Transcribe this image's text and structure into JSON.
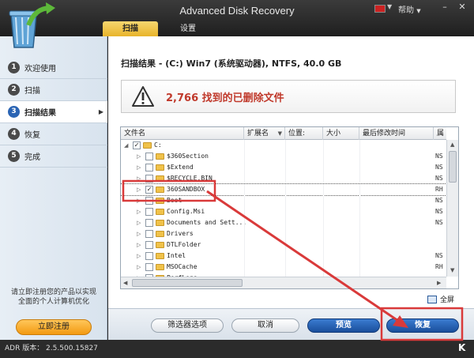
{
  "app": {
    "title": "Advanced Disk Recovery",
    "help_label": "帮助",
    "help_arrow": "▼",
    "minimize": "–",
    "close": "✕"
  },
  "tabs": [
    {
      "label": "扫描",
      "active": true
    },
    {
      "label": "设置",
      "active": false
    }
  ],
  "sidebar": {
    "items": [
      {
        "num": "1",
        "label": "欢迎使用",
        "active": false
      },
      {
        "num": "2",
        "label": "扫描",
        "active": false
      },
      {
        "num": "3",
        "label": "扫描结果",
        "active": true
      },
      {
        "num": "4",
        "label": "恢复",
        "active": false
      },
      {
        "num": "5",
        "label": "完成",
        "active": false
      }
    ],
    "promo_line1": "请立即注册您的产品以实现",
    "promo_line2": "全面的个人计算机优化",
    "register_label": "立即注册"
  },
  "main": {
    "heading": "扫描结果 - (C:) Win7 (系统驱动器), NTFS, 40.0 GB",
    "found_text": "2,766 找到的已删除文件",
    "columns": [
      "文件名",
      "扩展名",
      "位置:",
      "大小",
      "最后修改时间",
      "属"
    ],
    "rows": [
      {
        "name": "C:",
        "checked": true,
        "tail": ""
      },
      {
        "name": "$360Section",
        "checked": false,
        "tail": "NS"
      },
      {
        "name": "$Extend",
        "checked": false,
        "tail": "NS"
      },
      {
        "name": "$RECYCLE.BIN",
        "checked": false,
        "tail": "NS"
      },
      {
        "name": "360SANDBOX",
        "checked": true,
        "tail": "RH"
      },
      {
        "name": "Boot",
        "checked": false,
        "tail": "NS"
      },
      {
        "name": "Config.Msi",
        "checked": false,
        "tail": "NS"
      },
      {
        "name": "Documents and Sett...",
        "checked": false,
        "tail": "NS"
      },
      {
        "name": "Drivers",
        "checked": false,
        "tail": ""
      },
      {
        "name": "DTLFolder",
        "checked": false,
        "tail": ""
      },
      {
        "name": "Intel",
        "checked": false,
        "tail": "NS"
      },
      {
        "name": "MSOCache",
        "checked": false,
        "tail": "RH"
      },
      {
        "name": "PerfLogs",
        "checked": false,
        "tail": ""
      }
    ],
    "fullscreen_label": "全屏"
  },
  "buttons": {
    "filter": "筛选器选项",
    "cancel": "取消",
    "preview": "预览",
    "recover": "恢复"
  },
  "status": {
    "version": "ADR 版本： 2.5.500.15827"
  },
  "colors": {
    "accent_blue": "#1a4f9c",
    "highlight_red": "#d93a3a",
    "tab_gold": "#e8b42a",
    "register_orange": "#f39a12"
  }
}
